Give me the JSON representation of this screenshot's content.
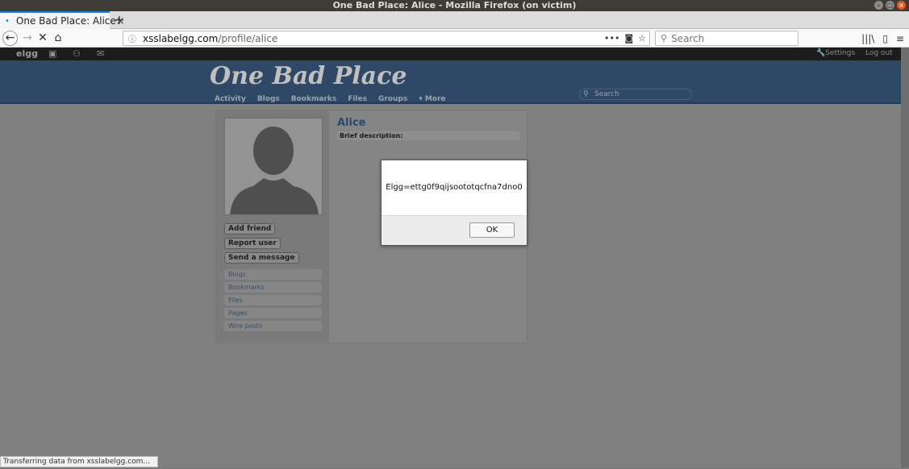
{
  "window": {
    "title": "One Bad Place: Alice - Mozilla Firefox (on victim)"
  },
  "tab": {
    "title": "One Bad Place: Alice",
    "close": "×",
    "new_tab": "+"
  },
  "nav": {
    "back": "←",
    "forward": "→",
    "stop": "✕",
    "home": "⌂",
    "url_host": "xsslabelgg.com",
    "url_path": "/profile/alice",
    "page_actions": "•••",
    "search_placeholder": "Search",
    "library": "|||\\",
    "sidebar": "▯",
    "menu": "≡"
  },
  "site": {
    "topbar": {
      "logo": "elgg",
      "settings": "Settings",
      "logout": "Log out"
    },
    "name": "One Bad Place",
    "menu": [
      "Activity",
      "Blogs",
      "Bookmarks",
      "Files",
      "Groups",
      "▾ More"
    ],
    "search_placeholder": "Search"
  },
  "profile": {
    "name": "Alice",
    "brief_label": "Brief description:",
    "actions": [
      "Add friend",
      "Report user",
      "Send a message"
    ],
    "links": [
      "Blogs",
      "Bookmarks",
      "Files",
      "Pages",
      "Wire posts"
    ]
  },
  "alert": {
    "message": "Elgg=ettg0f9qijsoototqcfna7dno0",
    "ok": "OK"
  },
  "status": "Transferring data from xsslabelgg.com..."
}
